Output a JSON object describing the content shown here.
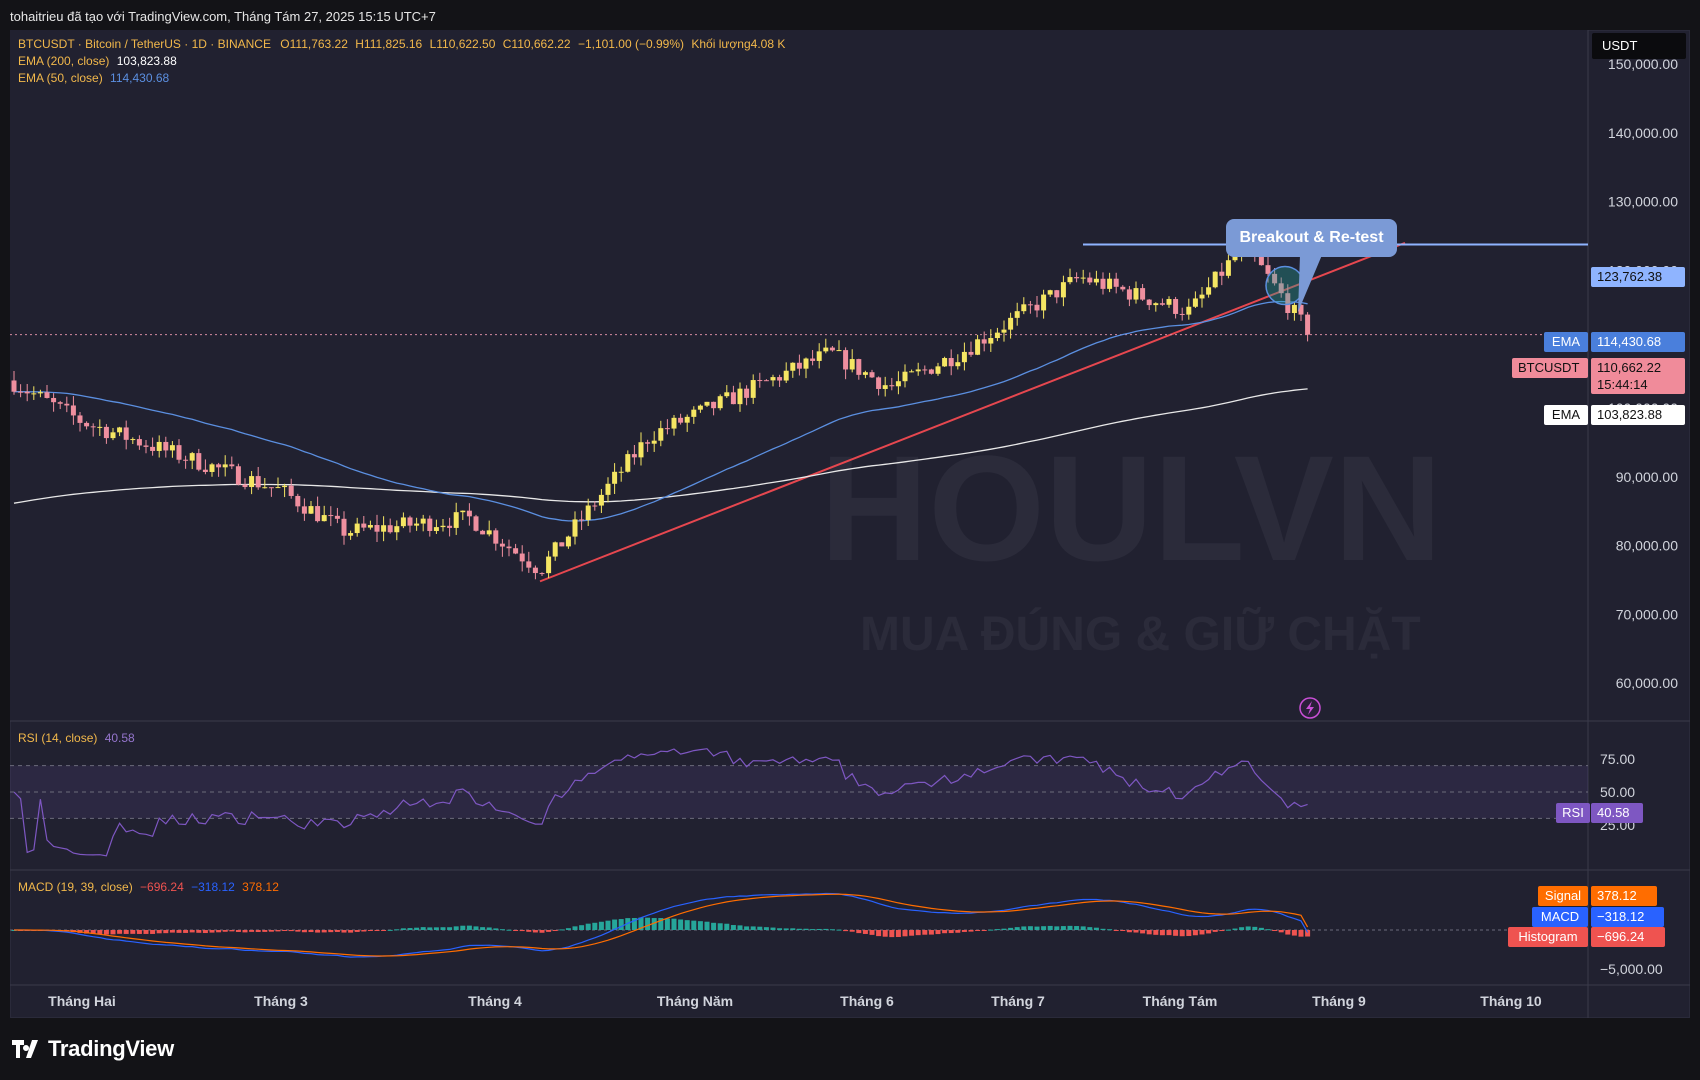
{
  "header": {
    "title": "tohaitrieu đã tạo với TradingView.com, Tháng Tám 27, 2025 15:15 UTC+7"
  },
  "legend": {
    "symbol": "BTCUSDT · Bitcoin / TetherUS · 1D · BINANCE",
    "open": "O111,763.22",
    "high": "H111,825.16",
    "low": "L110,622.50",
    "close": "C110,662.22",
    "change": "−1,101.00 (−0.99%)",
    "volume_label": "Khối lượng",
    "volume": "4.08 K",
    "ema200_label": "EMA (200, close)",
    "ema200_value": "103,823.88",
    "ema50_label": "EMA (50, close)",
    "ema50_value": "114,430.68"
  },
  "currency": "USDT",
  "annotation": "Breakout & Re-test",
  "price_tags": {
    "level": "123,762.38",
    "ema50_name": "EMA",
    "ema50": "114,430.68",
    "symbol": "BTCUSDT",
    "last": "110,662.22",
    "countdown": "15:44:14",
    "ema200_name": "EMA",
    "ema200": "103,823.88"
  },
  "rsi": {
    "label": "RSI (14, close)",
    "value": "40.58",
    "tag_name": "RSI"
  },
  "macd": {
    "label": "MACD (19, 39, close)",
    "histogram": "−696.24",
    "macd": "−318.12",
    "signal": "378.12",
    "tag_signal": "Signal",
    "tag_macd": "MACD",
    "tag_hist": "Histogram"
  },
  "watermark": {
    "line1": "HOULVN",
    "line2": "MUA ĐÚNG & GIỮ CHẶT"
  },
  "brand": "TradingView",
  "colors": {
    "up": "#f5e663",
    "down": "#ef8f9f",
    "ema50": "#5b8fe0",
    "ema200": "#e8e8e8",
    "trendline": "#e6474f",
    "level": "#8fb4ff",
    "rsi": "#7e57c2",
    "macd": "#2962ff",
    "signal": "#ff6d00",
    "hist_up": "#26a69a",
    "hist_down": "#ef5350"
  },
  "chart_data": {
    "type": "candlestick",
    "symbol": "BTCUSDT",
    "timeframe": "1D",
    "x_ticks": [
      "Tháng Hai",
      "Tháng 3",
      "Tháng 4",
      "Tháng Năm",
      "Tháng 6",
      "Tháng 7",
      "Tháng Tám",
      "Tháng 9",
      "Tháng 10"
    ],
    "y_ticks": [
      "150,000.00",
      "140,000.00",
      "130,000.00",
      "120,000.00",
      "100,000.00",
      "90,000.00",
      "80,000.00",
      "70,000.00",
      "60,000.00"
    ],
    "ylim": [
      60000,
      155000
    ],
    "price_points": [
      {
        "x": "Tháng Hai",
        "y": 98000
      },
      {
        "x": "Tháng 3",
        "y": 88000
      },
      {
        "x": "Tháng 3",
        "y": 82000
      },
      {
        "x": "Tháng 4",
        "y": 84000
      },
      {
        "x": "Tháng 4",
        "y": 76500
      },
      {
        "x": "Tháng Năm",
        "y": 96000
      },
      {
        "x": "Tháng 6",
        "y": 108000
      },
      {
        "x": "Tháng 6",
        "y": 103000
      },
      {
        "x": "Tháng 7",
        "y": 108000
      },
      {
        "x": "Tháng 7",
        "y": 119000
      },
      {
        "x": "Tháng Tám",
        "y": 114000
      },
      {
        "x": "Tháng Tám",
        "y": 123700
      },
      {
        "x": "Tháng 9",
        "y": 110662
      }
    ],
    "resistance_level": 123762.38,
    "last_price": 110662.22,
    "ema200_last": 103823.88,
    "ema50_last": 114430.68,
    "rsi": {
      "ylim": [
        0,
        100
      ],
      "ticks": [
        "75.00",
        "50.00",
        "25.00"
      ],
      "band": [
        30,
        70
      ],
      "last": 40.58
    },
    "macd": {
      "ticks": [
        "−5,000.00"
      ],
      "macd_last": -318.12,
      "signal_last": 378.12,
      "histogram_last": -696.24
    }
  }
}
